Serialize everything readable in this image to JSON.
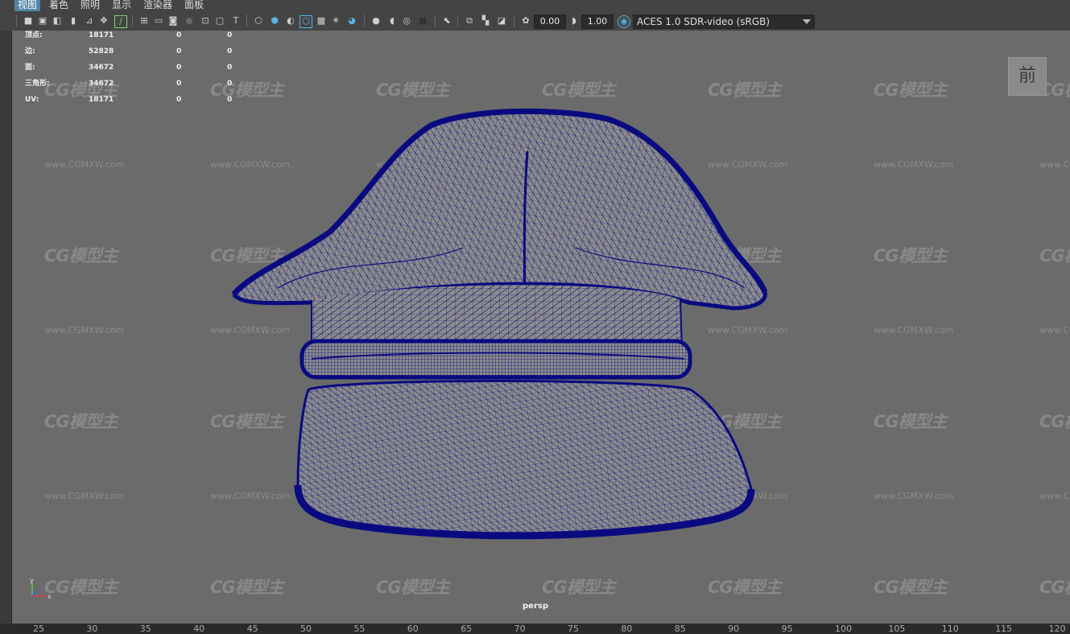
{
  "menu": {
    "items": [
      {
        "label": "视图",
        "active": true
      },
      {
        "label": "着色",
        "active": false
      },
      {
        "label": "照明",
        "active": false
      },
      {
        "label": "显示",
        "active": false
      },
      {
        "label": "渲染器",
        "active": false
      },
      {
        "label": "面板",
        "active": false
      }
    ]
  },
  "toolbar": {
    "exposure_value": "0.00",
    "gamma_value": "1.00",
    "color_space": "ACES 1.0 SDR-video (sRGB)",
    "icons": [
      "camera-select-icon",
      "camera-lock-icon",
      "camera-attributes-icon",
      "bookmark-icon",
      "image-plane-icon",
      "pan-zoom-icon",
      "grease-pencil-icon",
      "grid-icon",
      "film-gate-icon",
      "resolution-gate-icon",
      "gate-mask-icon",
      "field-chart-icon",
      "safe-action-icon",
      "safe-title-icon",
      "wireframe-icon",
      "smooth-shade-icon",
      "default-material-icon",
      "wireframe-on-shaded-icon",
      "textured-icon",
      "lights-icon",
      "shadows-icon",
      "ambient-occlusion-icon",
      "motion-blur-icon",
      "anti-aliasing-icon",
      "depth-of-field-icon",
      "isolate-select-icon",
      "xray-icon",
      "xray-joints-icon",
      "xray-components-icon",
      "exposure-icon",
      "gamma-icon",
      "color-management-icon"
    ]
  },
  "hud": {
    "rows": [
      {
        "label": "顶点:",
        "v1": "18171",
        "v2": "0",
        "v3": "0"
      },
      {
        "label": "边:",
        "v1": "52828",
        "v2": "0",
        "v3": "0"
      },
      {
        "label": "面:",
        "v1": "34672",
        "v2": "0",
        "v3": "0"
      },
      {
        "label": "三角形:",
        "v1": "34672",
        "v2": "0",
        "v3": "0"
      },
      {
        "label": "UV:",
        "v1": "18171",
        "v2": "0",
        "v3": "0"
      }
    ]
  },
  "viewport": {
    "view_cube_label": "前",
    "camera_name": "persp",
    "axis_labels": {
      "y": "y",
      "x": "x"
    },
    "watermark_text": "CG模型主",
    "watermark_url": "www.CGMXW.com",
    "model": "wireframe-peaked-cap",
    "wire_color": "#0a0a80",
    "shade_color": "#8c8c8c"
  },
  "timeline": {
    "ticks": [
      "25",
      "30",
      "35",
      "40",
      "45",
      "50",
      "55",
      "60",
      "65",
      "70",
      "75",
      "80",
      "85",
      "90",
      "95",
      "100",
      "105",
      "110",
      "115",
      "120"
    ]
  }
}
